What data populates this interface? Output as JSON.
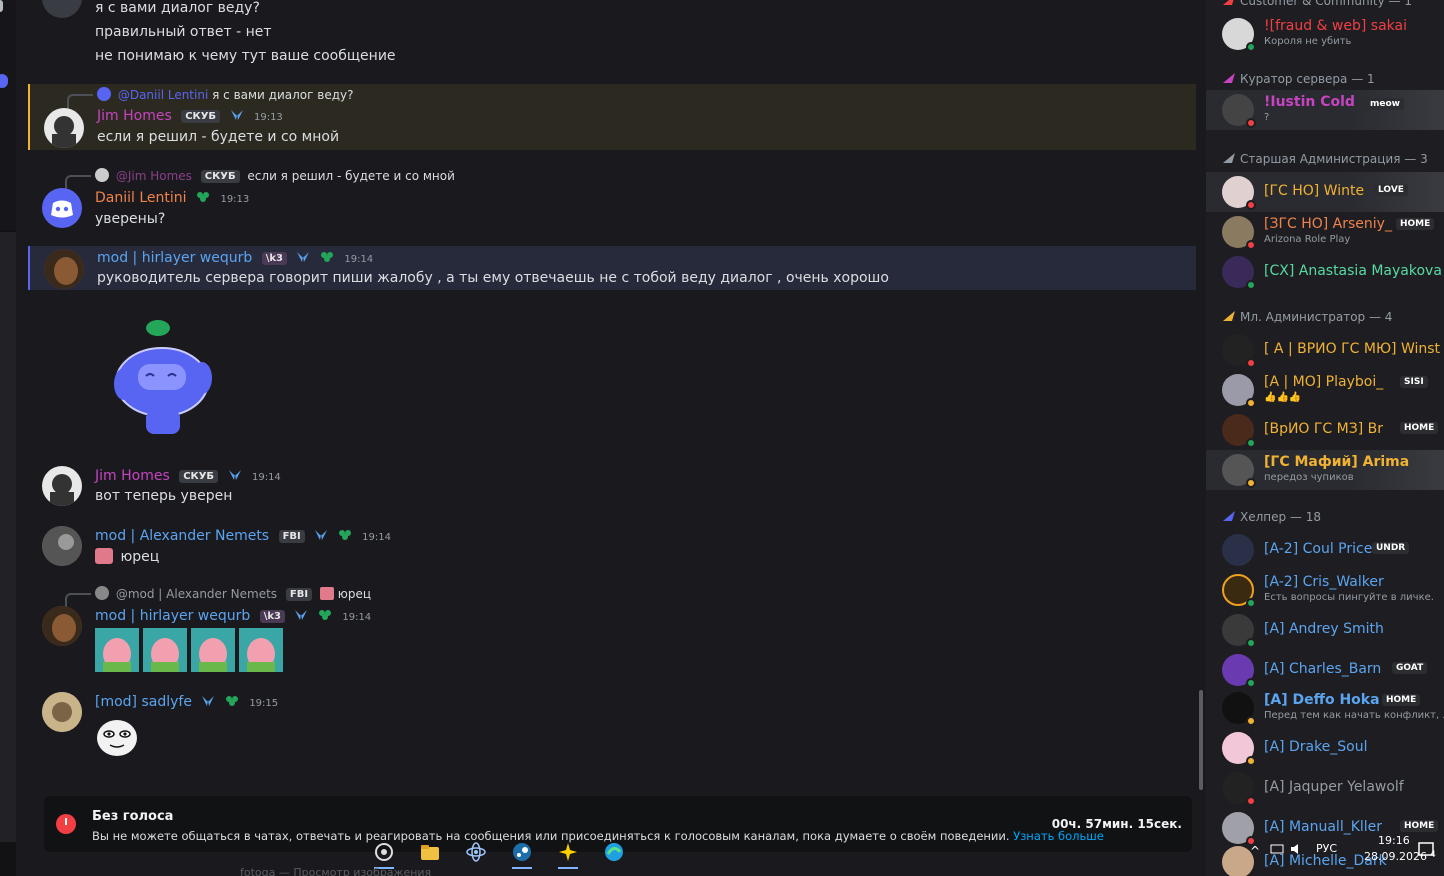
{
  "top_messages": [
    "я с вами диалог веду?",
    "правильный ответ - нет",
    "не понимаю к чему тут ваше сообщение"
  ],
  "messages": [
    {
      "reply": {
        "name": "@Daniil Lentini",
        "text": "я с вами диалог веду?"
      },
      "author": "Jim Homes",
      "tag": "СКУБ",
      "time": "19:13",
      "text": "если я решил - будете и со мной"
    },
    {
      "reply": {
        "name": "@Jim Homes",
        "tag": "СКУБ",
        "text": "если я решил - будете и со мной"
      },
      "author": "Daniil Lentini",
      "time": "19:13",
      "text": "уверены?"
    },
    {
      "author": "mod | hirlayer wequrb",
      "tag": "\\k3",
      "time": "19:14",
      "text": "руководитель сервера говорит пиши жалобу , а ты ему отвечаешь не с тобой веду диалог , очень хорошо"
    },
    {
      "author": "Jim Homes",
      "tag": "СКУБ",
      "time": "19:14",
      "text": "вот теперь уверен"
    },
    {
      "author": "mod |  Alexander Nemets",
      "tag": "FBI",
      "time": "19:14",
      "text": "юрец"
    },
    {
      "reply": {
        "name": "@mod |  Alexander Nemets",
        "tag": "FBI",
        "text": "юрец"
      },
      "author": "mod | hirlayer wequrb",
      "tag": "\\k3",
      "time": "19:14"
    },
    {
      "author": "[mod] sadlyfe",
      "time": "19:15"
    }
  ],
  "banner": {
    "title": "Без голоса",
    "text": "Вы не можете общаться в чатах, отвечать и реагировать на сообщения или присоединяться к голосовым каналам, пока думаете о своём поведении.",
    "link": "Узнать больше",
    "timer": "00ч. 57мин. 15сек."
  },
  "ghost_text": "fotoga — Просмотр изображения",
  "members": {
    "top_partial": "Customer & Community — 1",
    "top_member": {
      "name": "![fraud & web] sakai",
      "sub": "Короля не убить"
    },
    "categories": [
      {
        "title": "Куратор сервера — 1",
        "color": "#c644c2",
        "items": [
          {
            "name": "!Iustin Cold",
            "tag": "meow",
            "sub": "?",
            "color": "#c644c2"
          }
        ]
      },
      {
        "title": "Старшая Администрация — 3",
        "color": "#949ba4",
        "items": [
          {
            "name": "[ГС НО] Winte",
            "tag": "LOVE",
            "color": "#f0b232"
          },
          {
            "name": "[ЗГС НО] Arseniy_",
            "tag": "HOME",
            "sub": "Arizona Role Play",
            "color": "#f0834a"
          },
          {
            "name": "[СХ] Anastasia Mayakova",
            "color": "#57d9a3"
          }
        ]
      },
      {
        "title": "Мл. Администратор — 4",
        "color": "#f0b232",
        "items": [
          {
            "name": "[ A | ВРИО ГС МЮ] Winst",
            "color": "#f0b232"
          },
          {
            "name": "[A | МО] Playboi_",
            "tag": "SISI",
            "sub": "👍👍👍",
            "color": "#f0b232"
          },
          {
            "name": "[ВрИО ГС МЗ] Br",
            "tag": "HOME",
            "color": "#f0b232"
          },
          {
            "name": "[ГС Мафий] Arima",
            "sub": "передоз чупиков",
            "color": "#f0b232"
          }
        ]
      },
      {
        "title": "Хелпер — 18",
        "color": "#5865f2",
        "items": [
          {
            "name": "[A-2] Coul Price",
            "tag": "UNDR",
            "color": "#5ba4ef"
          },
          {
            "name": "[A-2] Cris_Walker",
            "sub": "Есть вопросы пингуйте в личке.",
            "color": "#5ba4ef"
          },
          {
            "name": "[A] Andrey Smith",
            "color": "#5ba4ef"
          },
          {
            "name": "[A] Charles_Barn",
            "tag": "GOAT",
            "color": "#5ba4ef"
          },
          {
            "name": "[A] Deffo Hoka",
            "tag": "HOME",
            "sub": "Перед тем как начать конфликт, ...",
            "color": "#5ba4ef"
          },
          {
            "name": "[A] Drake_Soul",
            "color": "#5ba4ef"
          },
          {
            "name": "[A] Jaquper Yelawolf",
            "color": "#949ba4"
          },
          {
            "name": "[A] Manuall_Kller",
            "tag": "HOME",
            "color": "#5ba4ef"
          },
          {
            "name": "[A] Michelle_Dark",
            "color": "#5ba4ef"
          }
        ]
      }
    ]
  },
  "tray": {
    "lang": "РУС",
    "time": "19:16",
    "date": "28.09.2026",
    "notif": "4"
  },
  "colors": {
    "pink": "#c644c2",
    "blue": "#5ba4ef",
    "orange": "#f0b232",
    "green": "#23a55a",
    "red": "#f23f43"
  }
}
